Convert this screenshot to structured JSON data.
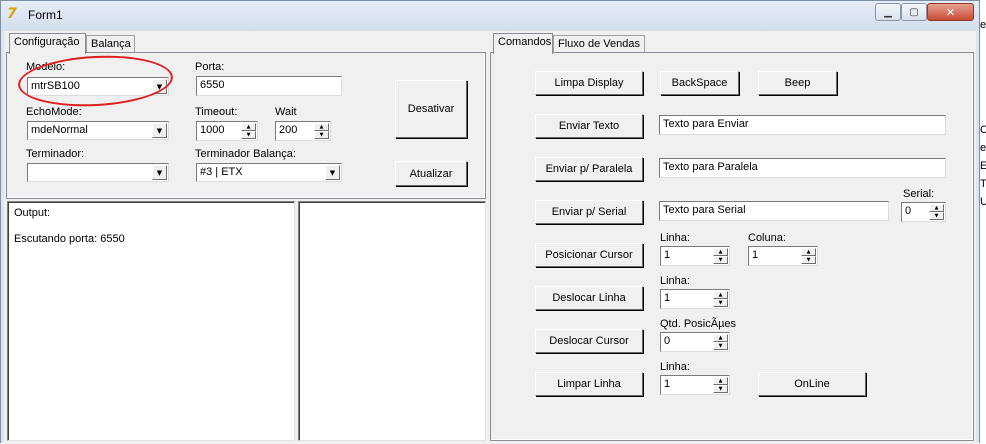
{
  "window": {
    "title": "Form1",
    "icon": "delphi-icon",
    "controls": {
      "minimize": "minimize-icon",
      "maximize": "maximize-icon",
      "close": "close-icon"
    }
  },
  "left_panel": {
    "tabs": [
      {
        "label": "Configuração",
        "active": true
      },
      {
        "label": "Balança",
        "active": false
      }
    ],
    "config": {
      "modelo_label": "Modelo:",
      "modelo_value": "mtrSB100",
      "porta_label": "Porta:",
      "porta_value": "6550",
      "echomode_label": "EchoMode:",
      "echomode_value": "mdeNormal",
      "timeout_label": "Timeout:",
      "timeout_value": "1000",
      "wait_label": "Wait",
      "wait_value": "200",
      "terminador_label": "Terminador:",
      "terminador_value": "",
      "terminador_balanca_label": "Terminador Balança:",
      "terminador_balanca_value": "#3 | ETX",
      "desativar_button": "Desativar",
      "atualizar_button": "Atualizar"
    },
    "output_lines": [
      "Output:",
      "",
      "Escutando porta: 6550"
    ],
    "highlight_color": "#e01f1f"
  },
  "right_panel": {
    "tabs": [
      {
        "label": "Comandos",
        "active": true
      },
      {
        "label": "Fluxo de Vendas",
        "active": false
      }
    ],
    "buttons": {
      "limpa_display": "Limpa Display",
      "backspace": "BackSpace",
      "beep": "Beep",
      "enviar_texto": "Enviar Texto",
      "enviar_paralela": "Enviar p/ Paralela",
      "enviar_serial": "Enviar p/ Serial",
      "posicionar_cursor": "Posicionar Cursor",
      "deslocar_linha": "Deslocar Linha",
      "deslocar_cursor": "Deslocar Cursor",
      "limpar_linha": "Limpar Linha",
      "online": "OnLine"
    },
    "fields": {
      "texto_enviar": "Texto para Enviar",
      "texto_paralela": "Texto para Paralela",
      "texto_serial": "Texto para Serial",
      "serial_label": "Serial:",
      "serial_value": "0",
      "pos_linha_label": "Linha:",
      "pos_linha_value": "1",
      "pos_coluna_label": "Coluna:",
      "pos_coluna_value": "1",
      "desl_linha_label": "Linha:",
      "desl_linha_value": "1",
      "qtd_pos_label": "Qtd. PosicÃµes",
      "qtd_pos_value": "0",
      "limpar_linha_label": "Linha:",
      "limpar_linha_value": "1"
    }
  },
  "background_letters": [
    "e",
    "C",
    "e",
    "E",
    "T",
    "U"
  ]
}
